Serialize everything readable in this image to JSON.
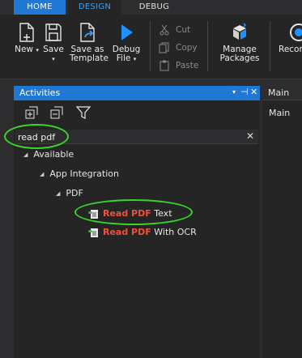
{
  "tabs": [
    {
      "label": "HOME"
    },
    {
      "label": "DESIGN"
    },
    {
      "label": "DEBUG"
    }
  ],
  "ribbon": {
    "new_label": "New",
    "save_label": "Save",
    "save_as_template_line1": "Save as",
    "save_as_template_line2": "Template",
    "debug_line1": "Debug",
    "debug_line2": "File",
    "cut_label": "Cut",
    "copy_label": "Copy",
    "paste_label": "Paste",
    "manage_line1": "Manage",
    "manage_line2": "Packages",
    "record_label": "Recor"
  },
  "activities_panel": {
    "title": "Activities",
    "search_value": "read pdf",
    "clear_glyph": "✕",
    "close_glyph": "✕",
    "pin_glyph": "⊣"
  },
  "tree": {
    "available": "Available",
    "app_integration": "App Integration",
    "pdf": "PDF",
    "items": [
      {
        "highlight": "Read PDF",
        "rest": " Text"
      },
      {
        "highlight": "Read PDF",
        "rest": " With OCR"
      }
    ]
  },
  "main_panel": {
    "tab_label": "Main",
    "body_label": "Main"
  },
  "colors": {
    "accent": "#1e78d4",
    "highlight_text": "#f0503c",
    "annotation": "#39d62c"
  }
}
